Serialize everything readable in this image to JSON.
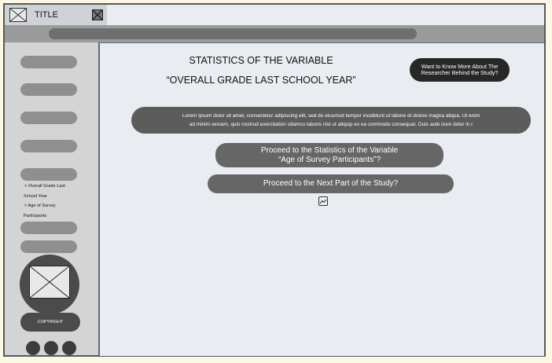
{
  "tab": {
    "title": "TITLE"
  },
  "sidebar": {
    "nav_items": [
      "> Overall Grade Last",
      "School Year",
      "> Age of Survey",
      "Participants"
    ],
    "copyright_label": "COPYRIGHT"
  },
  "main": {
    "heading_line1": "STATISTICS OF THE VARIABLE",
    "heading_line2": "“OVERALL GRADE LAST SCHOOL YEAR”",
    "researcher_button": "Want to Know More About The Researcher Behind the Study?",
    "lorem_line1": "Lorem ipsum dolor sit amet, consectetur adipiscing elit, sed do eiusmod tempor incididunt ut labore et dolore magna aliqua. Ut enim",
    "lorem_line2": "ad minim veniam, quis nostrud exercitation ullamco laboris nisi ut aliquip ex ea commodo consequat. Duis aute irure dolor in r",
    "proceed_stats_line1": "Proceed to the Statistics of the Variable",
    "proceed_stats_line2": "“Age of Survey Participants”?",
    "proceed_next": "Proceed to the Next Part of the Study?"
  },
  "icons": {
    "tab_thumbnail": "image-placeholder-icon",
    "tab_close": "close-icon",
    "avatar": "image-placeholder-icon",
    "small_image": "image-icon"
  }
}
